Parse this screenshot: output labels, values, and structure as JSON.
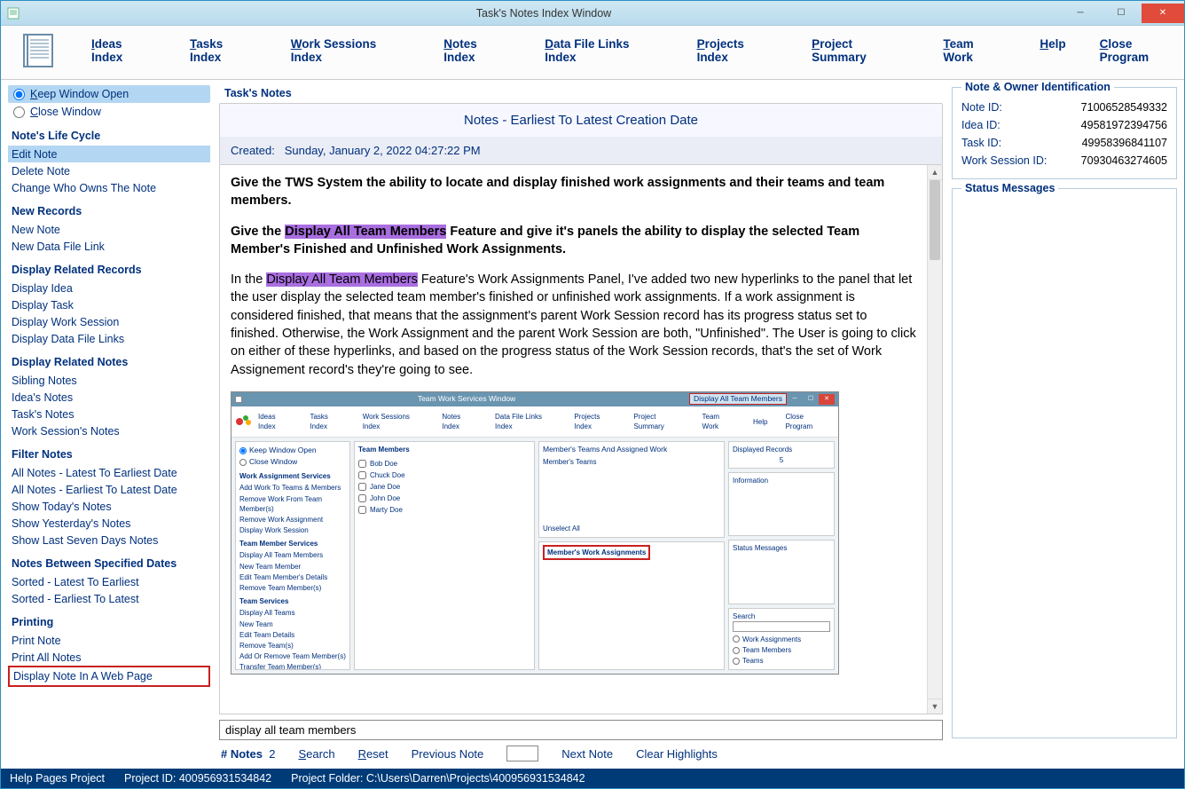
{
  "window": {
    "title": "Task's Notes Index Window"
  },
  "topnav": [
    {
      "u": "I",
      "rest": "deas Index"
    },
    {
      "u": "T",
      "rest": "asks Index"
    },
    {
      "u": "W",
      "rest": "ork Sessions Index"
    },
    {
      "u": "N",
      "rest": "otes Index"
    },
    {
      "u": "D",
      "rest": "ata File Links Index"
    },
    {
      "u": "P",
      "rest": "rojects Index"
    },
    {
      "u": "P",
      "rest": "roject Summary"
    },
    {
      "u": "T",
      "rest": "eam Work"
    },
    {
      "u": "H",
      "rest": "elp"
    },
    {
      "u": "C",
      "rest": "lose Program"
    }
  ],
  "sidebar": {
    "radios": {
      "keep": "eep Window Open",
      "keep_u": "K",
      "close": "lose Window",
      "close_u": "C"
    },
    "sections": {
      "life_cycle": {
        "heading": "Note's Life Cycle",
        "items": [
          "Edit Note",
          "Delete Note",
          "Change Who Owns The Note"
        ]
      },
      "new_records": {
        "heading": "New Records",
        "items": [
          "New Note",
          "New Data File Link"
        ]
      },
      "related_records": {
        "heading": "Display Related Records",
        "items": [
          "Display Idea",
          "Display Task",
          "Display Work Session",
          "Display Data File Links"
        ]
      },
      "related_notes": {
        "heading": "Display Related Notes",
        "items": [
          "Sibling Notes",
          "Idea's Notes",
          "Task's Notes",
          "Work Session's Notes"
        ]
      },
      "filter_notes": {
        "heading": "Filter Notes",
        "items": [
          "All Notes - Latest To Earliest Date",
          "All Notes - Earliest To Latest Date"
        ]
      },
      "show_notes": {
        "items": [
          "Show Today's Notes",
          "Show Yesterday's Notes",
          "Show Last Seven Days Notes"
        ]
      },
      "between_dates": {
        "heading": "Notes Between Specified Dates",
        "items": [
          "Sorted - Latest To Earliest",
          "Sorted - Earliest To Latest"
        ]
      },
      "printing": {
        "heading": "Printing",
        "items": [
          "Print Note",
          "Print All Notes",
          "Display Note In A Web Page"
        ]
      }
    }
  },
  "center": {
    "panel_title": "Task's Notes",
    "header_title": "Notes - Earliest To Latest Creation Date",
    "created_label": "Created:",
    "created_value": "Sunday, January 2, 2022   04:27:22 PM",
    "body": {
      "p1a": "Give the TWS System the ability to locate and display finished work assignments and their teams and team members.",
      "p2a": "Give the ",
      "p2hl": "Display All Team Members",
      "p2b": " Feature and give it's panels the ability to display the selected Team Member's Finished and Unfinished Work Assignments.",
      "p3a": "In the ",
      "p3hl": "Display All Team Members",
      "p3b": " Feature's Work Assignments Panel, I've added two new hyperlinks to the panel that let the user display the selected team member's finished or unfinished work assignments. If a work assignment is considered finished, that means that the assignment's parent Work Session record has its progress status set to finished. Otherwise, the Work Assignment and the parent Work Session are both, \"Unfinished\". The User is going to click on either of these hyperlinks, and based on the progress status of the Work Session records, that's the set of Work Assignement record's they're going to see."
    },
    "mini": {
      "title": "Team Work Services Window",
      "tag": "Display All Team Members",
      "nav": [
        "Ideas Index",
        "Tasks Index",
        "Work Sessions Index",
        "Notes Index",
        "Data File Links Index",
        "Projects Index",
        "Project Summary",
        "Team Work",
        "Help",
        "Close Program"
      ],
      "side_radios": [
        "Keep Window Open",
        "Close Window"
      ],
      "wa_services": {
        "h": "Work Assignment Services",
        "items": [
          "Add Work To Teams & Members",
          "Remove Work From Team Member(s)",
          "Remove Work Assignment",
          "Display Work Session"
        ]
      },
      "tm_services": {
        "h": "Team Member Services",
        "items": [
          "Display All Team Members",
          "New Team Member",
          "Edit Team Member's Details",
          "Remove Team Member(s)"
        ]
      },
      "team_services": {
        "h": "Team Services",
        "items": [
          "Display All Teams",
          "New Team",
          "Edit Team Details",
          "Remove Team(s)",
          "Add Or Remove Team Member(s)",
          "Transfer Team Member(s)"
        ]
      },
      "members_h": "Team Members",
      "members": [
        "Bob Doe",
        "Chuck Doe",
        "Jane Doe",
        "John Doe",
        "Marty Doe"
      ],
      "col2_h1": "Member's Teams And Assigned Work",
      "col2_sub1": "Member's Teams",
      "col2_unsel": "Unselect All",
      "col2_wa": "Member's Work Assignments",
      "right_disp_h": "Displayed Records",
      "right_disp_v": "5",
      "right_info_h": "Information",
      "right_status_h": "Status Messages",
      "right_search_h": "Search",
      "right_radios": [
        "Work Assignments",
        "Team Members",
        "Teams"
      ]
    },
    "search_value": "display all team members",
    "controls": {
      "count_label": "# Notes",
      "count_value": "2",
      "search": "earch",
      "search_u": "S",
      "reset": "eset",
      "reset_u": "R",
      "prev": "Previous Note",
      "next": "Next Note",
      "clear": "Clear Highlights"
    }
  },
  "right": {
    "ident_h": "Note & Owner Identification",
    "rows": [
      {
        "k": "Note ID:",
        "v": "71006528549332"
      },
      {
        "k": "Idea ID:",
        "v": "49581972394756"
      },
      {
        "k": "Task ID:",
        "v": "49958396841107"
      },
      {
        "k": "Work Session ID:",
        "v": "70930463274605"
      }
    ],
    "status_h": "Status Messages"
  },
  "statusbar": {
    "a": "Help Pages Project",
    "b": "Project ID:  400956931534842",
    "c": "Project Folder:  C:\\Users\\Darren\\Projects\\400956931534842"
  }
}
